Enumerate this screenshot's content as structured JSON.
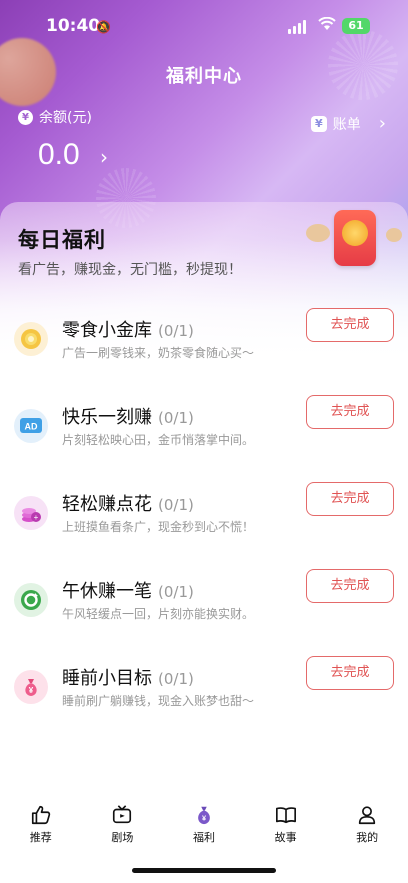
{
  "status_bar": {
    "time": "10:40",
    "battery": "61"
  },
  "header": {
    "title": "福利中心"
  },
  "balance": {
    "label": "余额(元)",
    "value": "0.0",
    "currency_icon": "yen-icon"
  },
  "bill": {
    "label": "账单",
    "icon": "bill-icon"
  },
  "daily": {
    "title": "每日福利",
    "subtitle": "看广告，赚现金，无门槛，秒提现！"
  },
  "tasks": [
    {
      "name": "零食小金库",
      "count": "(0/1)",
      "desc": "广告一刷零钱来，奶茶零食随心买～",
      "button": "去完成",
      "icon": "coin-icon"
    },
    {
      "name": "快乐一刻赚",
      "count": "(0/1)",
      "desc": "片刻轻松映心田，金币悄落掌中间。",
      "button": "去完成",
      "icon": "ad-icon"
    },
    {
      "name": "轻松赚点花",
      "count": "(0/1)",
      "desc": "上班摸鱼看条广，现金秒到心不慌！",
      "button": "去完成",
      "icon": "coin-stack-icon"
    },
    {
      "name": "午休赚一笔",
      "count": "(0/1)",
      "desc": "午风轻缓点一回，片刻亦能换实财。",
      "button": "去完成",
      "icon": "refresh-icon"
    },
    {
      "name": "睡前小目标",
      "count": "(0/1)",
      "desc": "睡前刷广躺赚钱，现金入账梦也甜～",
      "button": "去完成",
      "icon": "money-bag-icon"
    }
  ],
  "tabbar": [
    {
      "label": "推荐",
      "icon": "thumbs-up-icon"
    },
    {
      "label": "剧场",
      "icon": "tv-icon"
    },
    {
      "label": "福利",
      "icon": "money-bag-icon"
    },
    {
      "label": "故事",
      "icon": "book-icon"
    },
    {
      "label": "我的",
      "icon": "person-icon"
    }
  ]
}
